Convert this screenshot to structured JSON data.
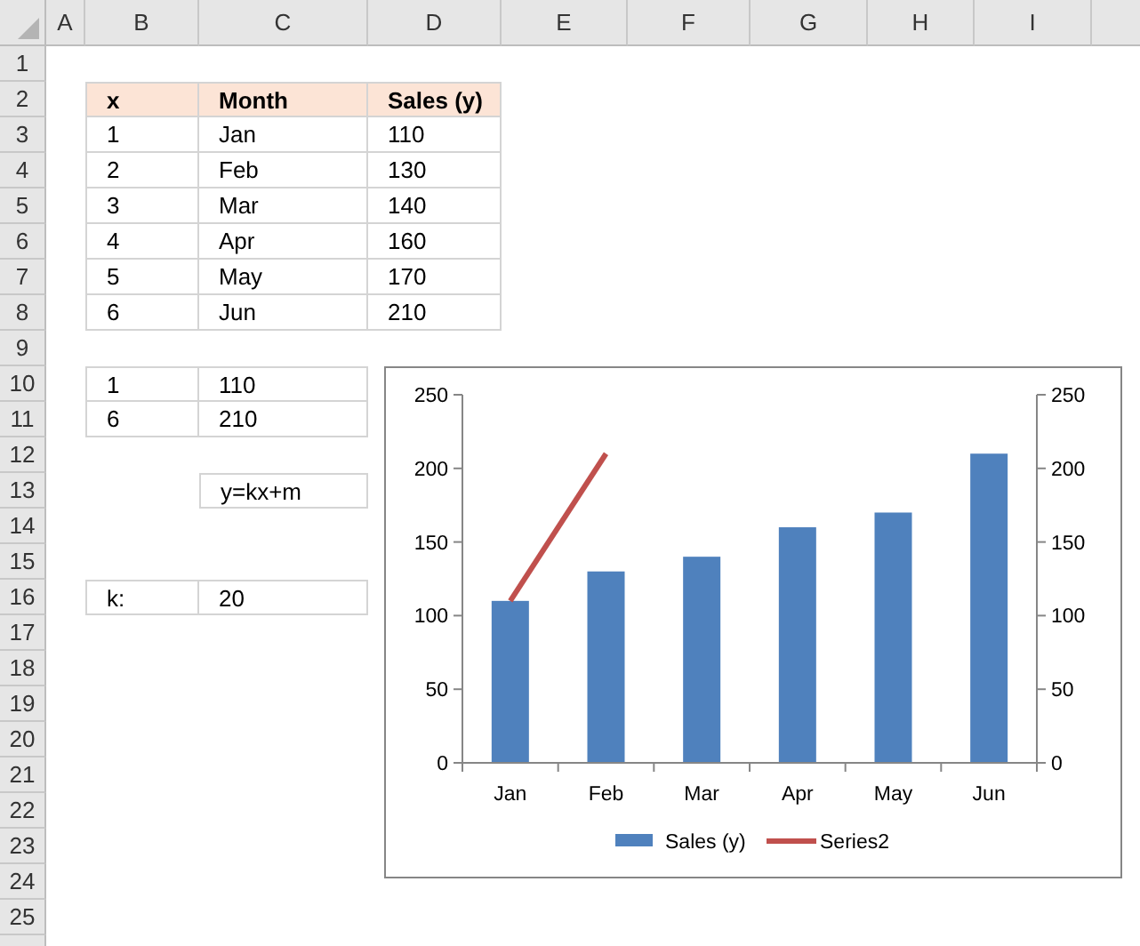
{
  "column_headers": [
    "A",
    "B",
    "C",
    "D",
    "E",
    "F",
    "G",
    "H",
    "I"
  ],
  "row_headers": [
    "1",
    "2",
    "3",
    "4",
    "5",
    "6",
    "7",
    "8",
    "9",
    "10",
    "11",
    "12",
    "13",
    "14",
    "15",
    "16",
    "17",
    "18",
    "19",
    "20",
    "21",
    "22",
    "23",
    "24",
    "25"
  ],
  "sales_table": {
    "columns": [
      "x",
      "Month",
      "Sales (y)"
    ],
    "rows": [
      [
        "1",
        "Jan",
        "110"
      ],
      [
        "2",
        "Feb",
        "130"
      ],
      [
        "3",
        "Mar",
        "140"
      ],
      [
        "4",
        "Apr",
        "160"
      ],
      [
        "5",
        "May",
        "170"
      ],
      [
        "6",
        "Jun",
        "210"
      ]
    ]
  },
  "points_table": {
    "rows": [
      [
        "1",
        "110"
      ],
      [
        "6",
        "210"
      ]
    ]
  },
  "formula": "y=kx+m",
  "slope": {
    "label": "k:",
    "value": "20"
  },
  "chart": {
    "chart_data": {
      "type": "bar",
      "categories": [
        "Jan",
        "Feb",
        "Mar",
        "Apr",
        "May",
        "Jun"
      ],
      "series": [
        {
          "name": "Sales (y)",
          "type": "bar",
          "color": "#4f81bd",
          "values": [
            110,
            130,
            140,
            160,
            170,
            210
          ]
        },
        {
          "name": "Series2",
          "type": "line",
          "color": "#c0504d",
          "values": [
            110,
            210,
            null,
            null,
            null,
            null
          ]
        }
      ],
      "ylim": [
        0,
        250
      ],
      "yticks": [
        0,
        50,
        100,
        150,
        200,
        250
      ],
      "legend": "bottom"
    },
    "secondary_axis_labels": [
      "250",
      "200",
      "150",
      "100",
      "50",
      "0"
    ]
  }
}
